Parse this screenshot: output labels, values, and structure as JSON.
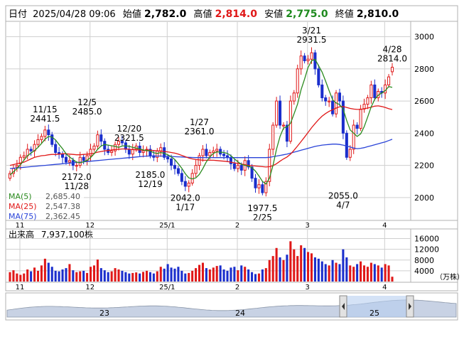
{
  "header": {
    "prefix": "日付",
    "date": "2025/04/28 09:06",
    "open_label": "始値",
    "open": "2,782.0",
    "high_label": "高値",
    "high": "2,814.0",
    "low_label": "安値",
    "low": "2,775.0",
    "close_label": "終値",
    "close": "2,810.0"
  },
  "legend": {
    "ma5": "MA(5)",
    "ma5_val": "2,685.40",
    "ma25": "MA(25)",
    "ma25_val": "2,547.38",
    "ma75": "MA(75)",
    "ma75_val": "2,362.45"
  },
  "volume": {
    "label": "出来高",
    "value": "7,937,100株",
    "unit": "（万株）",
    "ticks": [
      "16000",
      "12000",
      "8000",
      "4000"
    ]
  },
  "navigator": {
    "labels": [
      "23",
      "24",
      "25"
    ]
  },
  "colors": {
    "up": "#e01818",
    "down": "#1a2ecc",
    "ma5": "#2a8a1e",
    "ma25": "#e01818",
    "ma75": "#2a44d8",
    "grid": "#cfcfcf"
  },
  "chart_data": {
    "type": "candlestick",
    "ylim": [
      1880,
      3060
    ],
    "yticks": [
      2000,
      2200,
      2400,
      2600,
      2800,
      3000
    ],
    "x_month_labels": [
      "11",
      "12",
      "25/1",
      "2",
      "3",
      "4"
    ],
    "annotations": [
      {
        "date": "11/15",
        "value": "2441.5"
      },
      {
        "date": "12/5",
        "value": "2485.0"
      },
      {
        "date": "12/20",
        "value": "2321.5"
      },
      {
        "date": "1/27",
        "value": "2361.0"
      },
      {
        "date": "3/21",
        "value": "2931.5"
      },
      {
        "date": "4/28",
        "value": "2814.0"
      },
      {
        "date": "11/28",
        "value": "2172.0"
      },
      {
        "date": "12/19",
        "value": "2185.0"
      },
      {
        "date": "1/17",
        "value": "2042.0"
      },
      {
        "date": "2/25",
        "value": "1977.5"
      },
      {
        "date": "4/7",
        "value": "2055.0"
      }
    ],
    "close": [
      2150,
      2180,
      2200,
      2250,
      2260,
      2300,
      2290,
      2330,
      2360,
      2380,
      2420,
      2390,
      2330,
      2280,
      2270,
      2250,
      2220,
      2230,
      2200,
      2200,
      2250,
      2230,
      2260,
      2300,
      2320,
      2390,
      2350,
      2300,
      2280,
      2290,
      2330,
      2350,
      2340,
      2300,
      2270,
      2300,
      2320,
      2280,
      2290,
      2300,
      2260,
      2250,
      2290,
      2310,
      2250,
      2240,
      2200,
      2180,
      2150,
      2100,
      2070,
      2090,
      2150,
      2200,
      2260,
      2300,
      2260,
      2280,
      2290,
      2300,
      2270,
      2260,
      2250,
      2210,
      2180,
      2200,
      2170,
      2230,
      2190,
      2120,
      2060,
      2080,
      2030,
      2100,
      2300,
      2450,
      2600,
      2450,
      2450,
      2350,
      2600,
      2650,
      2800,
      2880,
      2850,
      2860,
      2900,
      2800,
      2700,
      2620,
      2600,
      2600,
      2520,
      2650,
      2600,
      2400,
      2250,
      2300,
      2450,
      2430,
      2550,
      2580,
      2620,
      2700,
      2620,
      2660,
      2650,
      2700,
      2750,
      2810
    ],
    "open": [
      2120,
      2150,
      2190,
      2210,
      2250,
      2260,
      2300,
      2290,
      2330,
      2360,
      2380,
      2420,
      2390,
      2330,
      2280,
      2270,
      2250,
      2220,
      2230,
      2200,
      2200,
      2250,
      2230,
      2260,
      2300,
      2320,
      2390,
      2350,
      2300,
      2280,
      2290,
      2330,
      2350,
      2340,
      2300,
      2270,
      2300,
      2320,
      2280,
      2290,
      2300,
      2260,
      2250,
      2290,
      2310,
      2250,
      2240,
      2200,
      2180,
      2150,
      2100,
      2070,
      2090,
      2150,
      2200,
      2260,
      2300,
      2260,
      2280,
      2290,
      2300,
      2270,
      2260,
      2250,
      2210,
      2180,
      2200,
      2170,
      2230,
      2190,
      2120,
      2060,
      2080,
      2030,
      2100,
      2300,
      2450,
      2600,
      2450,
      2450,
      2350,
      2600,
      2650,
      2800,
      2880,
      2850,
      2860,
      2900,
      2800,
      2700,
      2620,
      2600,
      2600,
      2520,
      2650,
      2600,
      2400,
      2250,
      2300,
      2450,
      2430,
      2550,
      2580,
      2620,
      2700,
      2620,
      2660,
      2650,
      2700,
      2782
    ],
    "ma5": [
      2140,
      2160,
      2180,
      2205,
      2232,
      2260,
      2276,
      2292,
      2312,
      2336,
      2362,
      2380,
      2376,
      2358,
      2330,
      2304,
      2272,
      2252,
      2236,
      2220,
      2216,
      2222,
      2232,
      2248,
      2272,
      2300,
      2320,
      2330,
      2326,
      2322,
      2318,
      2312,
      2320,
      2322,
      2318,
      2312,
      2308,
      2302,
      2296,
      2292,
      2290,
      2278,
      2274,
      2280,
      2274,
      2266,
      2254,
      2236,
      2210,
      2182,
      2148,
      2122,
      2116,
      2122,
      2144,
      2180,
      2222,
      2252,
      2274,
      2284,
      2282,
      2280,
      2274,
      2260,
      2240,
      2222,
      2206,
      2200,
      2196,
      2186,
      2164,
      2134,
      2100,
      2084,
      2120,
      2200,
      2300,
      2380,
      2432,
      2440,
      2462,
      2520,
      2580,
      2670,
      2736,
      2808,
      2850,
      2860,
      2820,
      2780,
      2724,
      2664,
      2608,
      2588,
      2578,
      2550,
      2480,
      2420,
      2400,
      2380,
      2396,
      2440,
      2500,
      2564,
      2610,
      2636,
      2650,
      2664,
      2690,
      2685
    ],
    "ma25": [
      2200,
      2205,
      2210,
      2215,
      2220,
      2230,
      2240,
      2250,
      2255,
      2260,
      2262,
      2266,
      2268,
      2268,
      2270,
      2272,
      2272,
      2270,
      2268,
      2266,
      2266,
      2268,
      2270,
      2272,
      2276,
      2282,
      2286,
      2290,
      2292,
      2296,
      2298,
      2300,
      2302,
      2302,
      2300,
      2298,
      2296,
      2296,
      2295,
      2295,
      2294,
      2292,
      2290,
      2288,
      2286,
      2284,
      2280,
      2276,
      2270,
      2262,
      2254,
      2246,
      2240,
      2236,
      2234,
      2232,
      2232,
      2232,
      2232,
      2230,
      2228,
      2226,
      2224,
      2220,
      2216,
      2212,
      2208,
      2204,
      2200,
      2198,
      2196,
      2194,
      2192,
      2190,
      2192,
      2198,
      2210,
      2226,
      2240,
      2252,
      2270,
      2294,
      2320,
      2348,
      2376,
      2404,
      2434,
      2460,
      2484,
      2506,
      2522,
      2536,
      2546,
      2556,
      2564,
      2566,
      2560,
      2554,
      2550,
      2548,
      2548,
      2552,
      2556,
      2562,
      2568,
      2570,
      2566,
      2560,
      2552,
      2547
    ],
    "ma75": [
      2180,
      2182,
      2184,
      2186,
      2188,
      2190,
      2192,
      2194,
      2196,
      2198,
      2200,
      2202,
      2204,
      2206,
      2208,
      2210,
      2212,
      2214,
      2216,
      2218,
      2220,
      2222,
      2224,
      2226,
      2228,
      2230,
      2232,
      2234,
      2236,
      2238,
      2240,
      2242,
      2244,
      2246,
      2248,
      2250,
      2252,
      2254,
      2256,
      2258,
      2258,
      2258,
      2258,
      2258,
      2257,
      2256,
      2255,
      2254,
      2253,
      2252,
      2251,
      2250,
      2249,
      2248,
      2248,
      2248,
      2248,
      2248,
      2248,
      2248,
      2248,
      2248,
      2248,
      2248,
      2248,
      2248,
      2248,
      2248,
      2248,
      2248,
      2248,
      2248,
      2248,
      2248,
      2250,
      2254,
      2258,
      2262,
      2266,
      2270,
      2276,
      2282,
      2288,
      2294,
      2300,
      2306,
      2312,
      2318,
      2322,
      2326,
      2328,
      2330,
      2332,
      2332,
      2330,
      2326,
      2320,
      2314,
      2308,
      2304,
      2306,
      2310,
      2316,
      2322,
      2328,
      2334,
      2340,
      2346,
      2354,
      2362
    ],
    "volume": [
      3500,
      4200,
      3000,
      2500,
      3000,
      4500,
      3800,
      5200,
      4000,
      6000,
      8500,
      7000,
      5500,
      4000,
      3800,
      4500,
      5000,
      6500,
      4200,
      3500,
      3800,
      4000,
      3200,
      5500,
      6000,
      8200,
      5000,
      4200,
      3500,
      3800,
      5000,
      4500,
      4000,
      3500,
      3000,
      3200,
      3400,
      3000,
      3600,
      4000,
      3500,
      3000,
      3800,
      5500,
      4800,
      6500,
      5200,
      4800,
      5500,
      4000,
      3000,
      3200,
      4000,
      5000,
      6200,
      7000,
      5000,
      4500,
      5200,
      5800,
      6000,
      4500,
      4000,
      5200,
      5500,
      4200,
      6000,
      5500,
      4500,
      3500,
      2800,
      3000,
      4500,
      5000,
      8000,
      9500,
      12500,
      9000,
      8000,
      10000,
      15000,
      12000,
      9500,
      13500,
      12500,
      11000,
      10500,
      9000,
      8500,
      7500,
      6500,
      6000,
      8000,
      7000,
      6500,
      12000,
      9000,
      6000,
      5500,
      6500,
      7500,
      6000,
      5500,
      7000,
      6500,
      6000,
      5200,
      6500,
      6000,
      1800
    ]
  }
}
